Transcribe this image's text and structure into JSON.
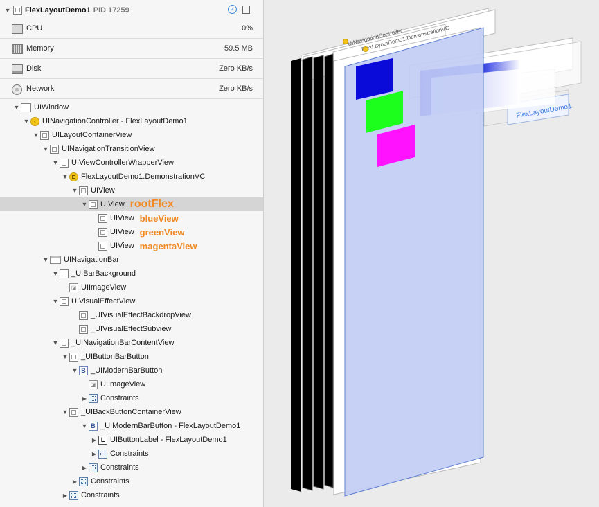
{
  "process": {
    "name": "FlexLayoutDemo1",
    "pid_label": "PID 17259"
  },
  "gauges": [
    {
      "label": "CPU",
      "value": "0%",
      "icon": "cpu-icon"
    },
    {
      "label": "Memory",
      "value": "59.5 MB",
      "icon": "memory-icon"
    },
    {
      "label": "Disk",
      "value": "Zero KB/s",
      "icon": "disk-icon"
    },
    {
      "label": "Network",
      "value": "Zero KB/s",
      "icon": "network-icon"
    }
  ],
  "tree": [
    {
      "label": "UIWindow",
      "annotation": ""
    },
    {
      "label": "UINavigationController - FlexLayoutDemo1",
      "annotation": ""
    },
    {
      "label": "UILayoutContainerView",
      "annotation": ""
    },
    {
      "label": "UINavigationTransitionView",
      "annotation": ""
    },
    {
      "label": "UIViewControllerWrapperView",
      "annotation": ""
    },
    {
      "label": "FlexLayoutDemo1.DemonstrationVC",
      "annotation": ""
    },
    {
      "label": "UIView",
      "annotation": ""
    },
    {
      "label": "UIView",
      "annotation": "rootFlex"
    },
    {
      "label": "UIView",
      "annotation": "blueView"
    },
    {
      "label": "UIView",
      "annotation": "greenView"
    },
    {
      "label": "UIView",
      "annotation": "magentaView"
    },
    {
      "label": "UINavigationBar",
      "annotation": ""
    },
    {
      "label": "_UIBarBackground",
      "annotation": ""
    },
    {
      "label": "UIImageView",
      "annotation": ""
    },
    {
      "label": "UIVisualEffectView",
      "annotation": ""
    },
    {
      "label": "_UIVisualEffectBackdropView",
      "annotation": ""
    },
    {
      "label": "_UIVisualEffectSubview",
      "annotation": ""
    },
    {
      "label": "_UINavigationBarContentView",
      "annotation": ""
    },
    {
      "label": "_UIButtonBarButton",
      "annotation": ""
    },
    {
      "label": "_UIModernBarButton",
      "annotation": ""
    },
    {
      "label": "UIImageView",
      "annotation": ""
    },
    {
      "label": "Constraints",
      "annotation": ""
    },
    {
      "label": "_UIBackButtonContainerView",
      "annotation": ""
    },
    {
      "label": "_UIModernBarButton - FlexLayoutDemo1",
      "annotation": ""
    },
    {
      "label": "UIButtonLabel - FlexLayoutDemo1",
      "annotation": ""
    },
    {
      "label": "Constraints",
      "annotation": ""
    },
    {
      "label": "Constraints",
      "annotation": ""
    },
    {
      "label": "Constraints",
      "annotation": ""
    },
    {
      "label": "Constraints",
      "annotation": ""
    }
  ],
  "canvas": {
    "nav_controller_label": "UINavigationController",
    "demo_vc_label": "FlexLayoutDemo1.DemonstrationVC",
    "back_button_text": "FlexLayoutDemo1",
    "colors": {
      "blue": "#0b0bd9",
      "green": "#1cff1c",
      "magenta": "#ff13ff",
      "glass": "#c2cdf5"
    }
  }
}
